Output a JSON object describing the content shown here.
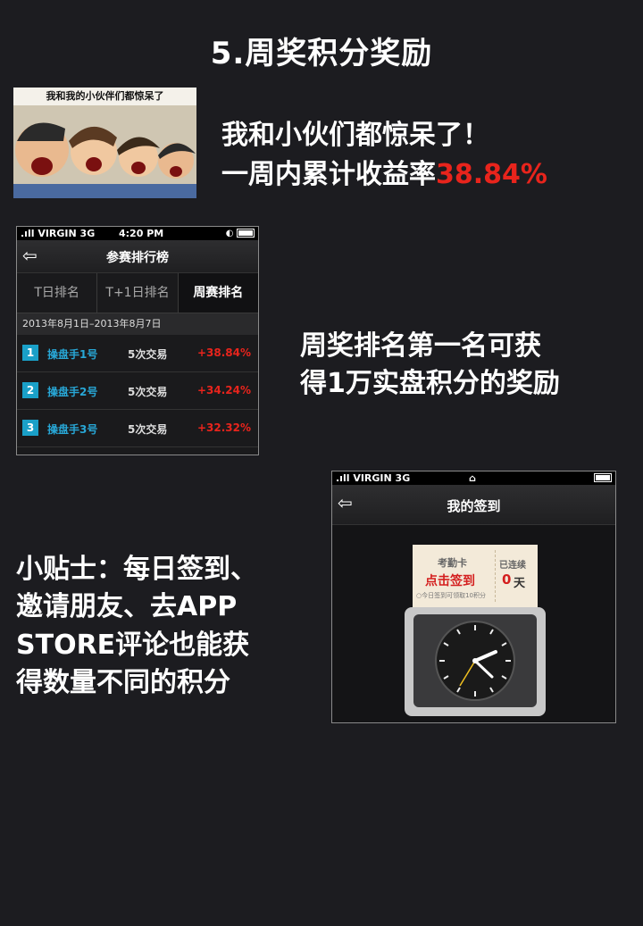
{
  "page_title": "5.周奖积分奖励",
  "meme": {
    "caption": "我和我的小伙伴们都惊呆了"
  },
  "intro": {
    "line1": "我和小伙们都惊呆了！",
    "line2_prefix": "一周内累计收益率",
    "line2_rate": "38.84%"
  },
  "leaderboard": {
    "status": {
      "carrier": ".ıll VIRGIN  3G",
      "time": "4:20 PM",
      "right": "◐"
    },
    "title": "参赛排行榜",
    "tabs": [
      {
        "label": "T日排名"
      },
      {
        "label": "T+1日排名"
      },
      {
        "label": "周赛排名"
      }
    ],
    "date_range": "2013年8月1日–2013年8月7日",
    "rows": [
      {
        "rank": "1",
        "name": "操盘手1号",
        "trades": "5次交易",
        "pct": "+38.84%"
      },
      {
        "rank": "2",
        "name": "操盘手2号",
        "trades": "5次交易",
        "pct": "+34.24%"
      },
      {
        "rank": "3",
        "name": "操盘手3号",
        "trades": "5次交易",
        "pct": "+32.32%"
      }
    ]
  },
  "prize": {
    "line1": "周奖排名第一名可获",
    "line2": "得1万实盘积分的奖励"
  },
  "tip": {
    "line1": "小贴士：每日签到、",
    "line2": "邀请朋友、去APP",
    "line3": "STORE评论也能获",
    "line4": "得数量不同的积分"
  },
  "checkin": {
    "status": {
      "carrier": ".ıll VIRGIN  3G",
      "lock": "🔒"
    },
    "title": "我的签到",
    "card_title": "考勤卡",
    "button": "点击签到",
    "note": "○今日签到可领取10积分",
    "streak_label": "已连续",
    "streak_days": "0",
    "streak_unit": "天"
  },
  "colors": {
    "background": "#1c1c20",
    "accent_red": "#e8241c",
    "accent_blue": "#1aa0c8"
  }
}
